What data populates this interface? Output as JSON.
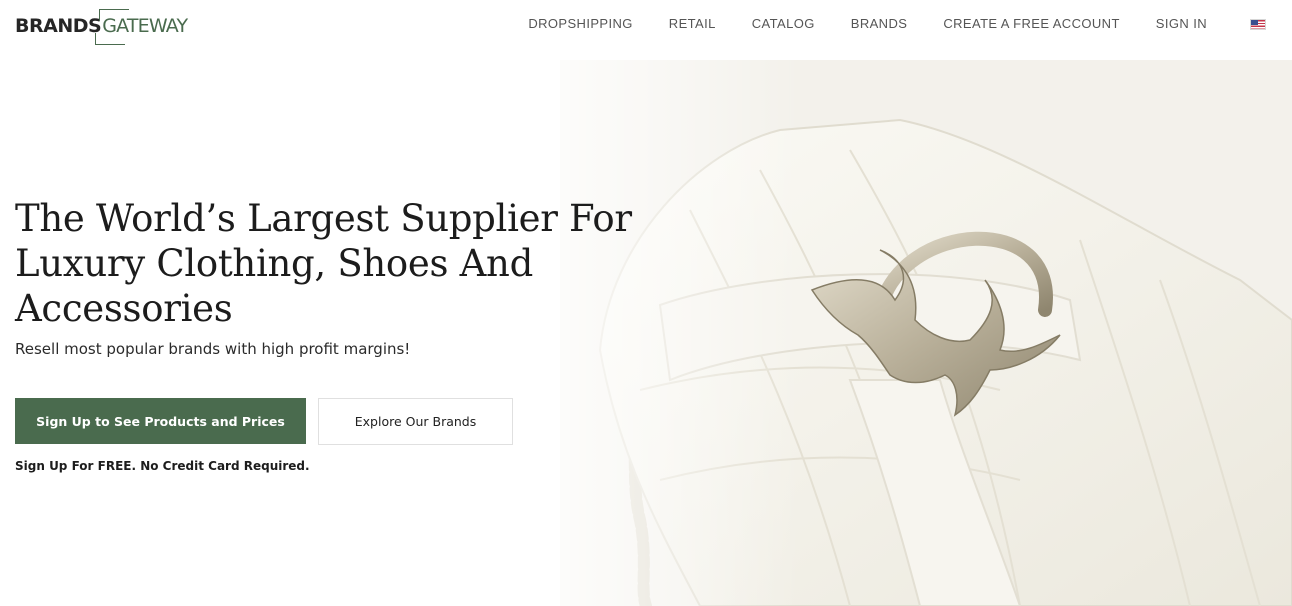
{
  "logo": {
    "part1": "BRANDS",
    "part2": "GATEWAY"
  },
  "nav": {
    "items": [
      {
        "label": "DROPSHIPPING"
      },
      {
        "label": "RETAIL"
      },
      {
        "label": "CATALOG"
      },
      {
        "label": "BRANDS"
      },
      {
        "label": "CREATE A FREE ACCOUNT"
      },
      {
        "label": "SIGN IN"
      }
    ],
    "flag_icon": "us-flag-icon"
  },
  "hero": {
    "headline": "The World’s Largest Supplier For Luxury Clothing, Shoes And Accessories",
    "subline": "Resell most popular brands with high profit margins!",
    "primary_button": "Sign Up to See Products and Prices",
    "secondary_button": "Explore Our Brands",
    "note": "Sign Up For FREE. No Credit Card Required.",
    "image_subject": "white quilted handbag with gold bird clasp"
  },
  "colors": {
    "brand_green": "#4a6b4e",
    "text_dark": "#1c1c1c",
    "nav_text": "#555555"
  }
}
